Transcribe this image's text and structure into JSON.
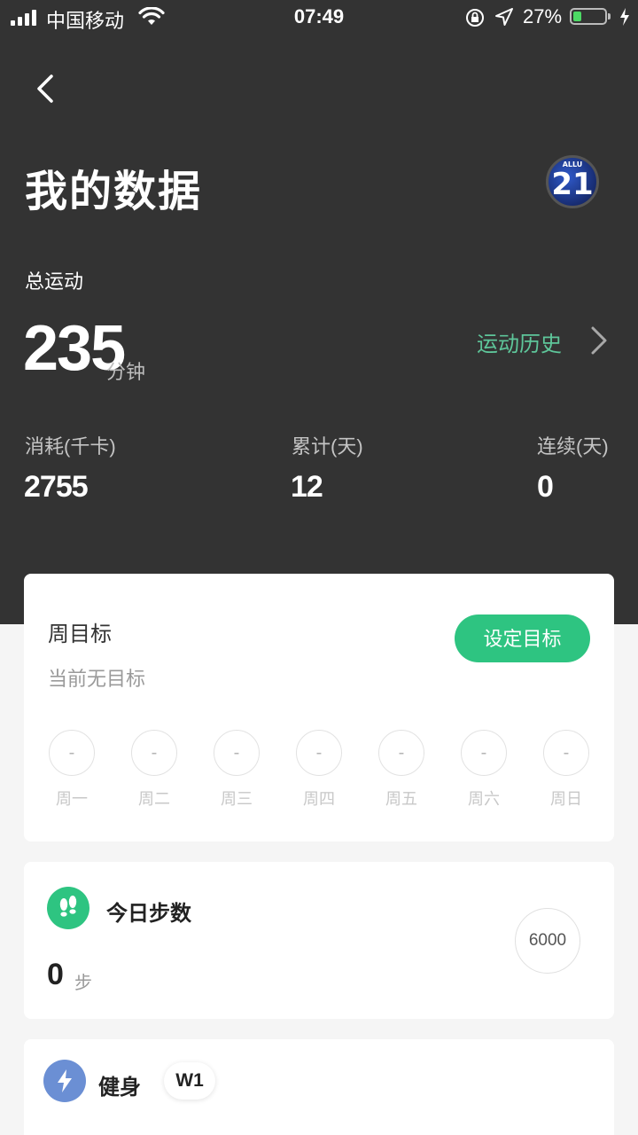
{
  "status_bar": {
    "carrier": "中国移动",
    "time": "07:49",
    "battery_percent_text": "27%",
    "battery_level": 0.27
  },
  "header": {
    "title": "我的数据",
    "avatar_text": "21",
    "avatar_small_text": "ALLU"
  },
  "summary": {
    "total_label": "总运动",
    "total_value": "235",
    "total_unit": "分钟",
    "history_link": "运动历史",
    "stats": [
      {
        "label": "消耗(千卡)",
        "value": "2755"
      },
      {
        "label": "累计(天)",
        "value": "12"
      },
      {
        "label": "连续(天)",
        "value": "0"
      }
    ]
  },
  "weekly_goal": {
    "title": "周目标",
    "subtitle": "当前无目标",
    "button": "设定目标",
    "days": [
      {
        "label": "周一",
        "value": "-"
      },
      {
        "label": "周二",
        "value": "-"
      },
      {
        "label": "周三",
        "value": "-"
      },
      {
        "label": "周四",
        "value": "-"
      },
      {
        "label": "周五",
        "value": "-"
      },
      {
        "label": "周六",
        "value": "-"
      },
      {
        "label": "周日",
        "value": "-"
      }
    ]
  },
  "steps": {
    "title": "今日步数",
    "value": "0",
    "unit": "步",
    "target": "6000"
  },
  "fitness": {
    "title": "健身",
    "badge": "W1"
  },
  "colors": {
    "header_bg": "#333333",
    "accent_green": "#2ec481",
    "link_green": "#5ec69a",
    "fitness_blue": "#6b8fd4"
  },
  "icons": {
    "back": "chevron-left-icon",
    "history": "chevron-right-icon",
    "steps": "footprints-icon",
    "fitness": "lightning-icon"
  }
}
